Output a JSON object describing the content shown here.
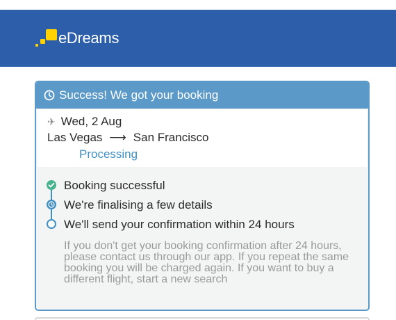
{
  "header": {
    "logo_text": "eDreams",
    "brand_color": "#2c5ea9",
    "logo_color": "#ffd200"
  },
  "card": {
    "title": "Success! We got your booking",
    "title_icon": "clock-icon",
    "accent_color": "#5b9ac8",
    "trip": {
      "icon": "plane-icon",
      "date": "Wed, 2 Aug",
      "origin": "Las Vegas",
      "arrow": "⟶",
      "destination": "San Francisco",
      "status": "Processing"
    },
    "steps": [
      {
        "label": "Booking successful",
        "state": "done"
      },
      {
        "label": "We're finalising a few details",
        "state": "current"
      },
      {
        "label": "We'll send your confirmation within 24 hours",
        "state": "pending"
      }
    ],
    "note": "If you don't get your booking confirmation after 24 hours, please contact us through our app. If you repeat the same booking you will be charged again. If you want to buy a different flight, start a new search"
  }
}
